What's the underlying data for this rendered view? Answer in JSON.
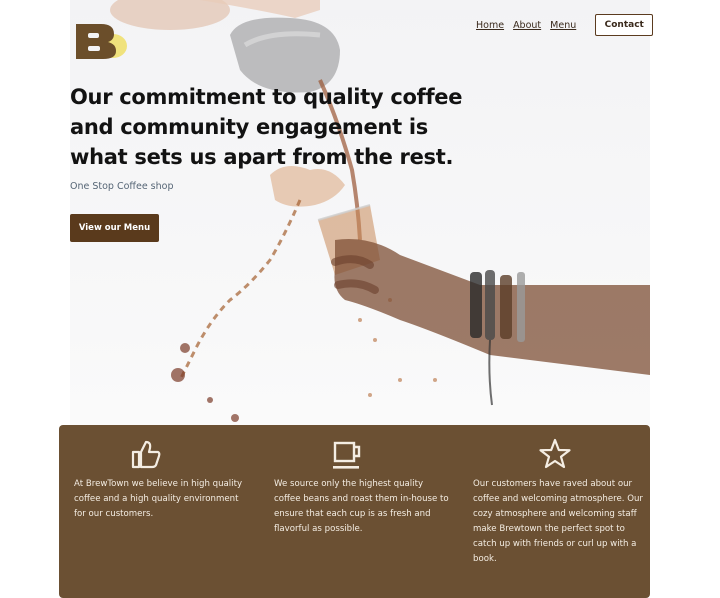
{
  "nav": {
    "links": [
      "Home",
      "About",
      "Menu"
    ],
    "contact_label": "Contact"
  },
  "logo": {
    "letter": "B"
  },
  "hero": {
    "headline": "Our commitment to quality coffee and community engagement is what sets us apart from the rest.",
    "subtitle": "One Stop Coffee shop",
    "cta_label": "View our Menu"
  },
  "features": [
    {
      "icon": "thumbs-up-icon",
      "text": "At BrewTown we believe in high quality coffee and a high quality environment for our customers."
    },
    {
      "icon": "coffee-cup-icon",
      "text": "We source only the highest quality coffee beans and roast them in-house to ensure that each cup is as fresh and flavorful as possible."
    },
    {
      "icon": "star-icon",
      "text": "Our customers have raved about our coffee and welcoming atmosphere. Our cozy atmosphere and welcoming staff make Brewtown the perfect spot to catch up with friends or curl up with a book."
    }
  ],
  "colors": {
    "brand_brown": "#5a3a1c",
    "feature_bg": "#6b5033",
    "feature_text": "#f4ede3"
  }
}
